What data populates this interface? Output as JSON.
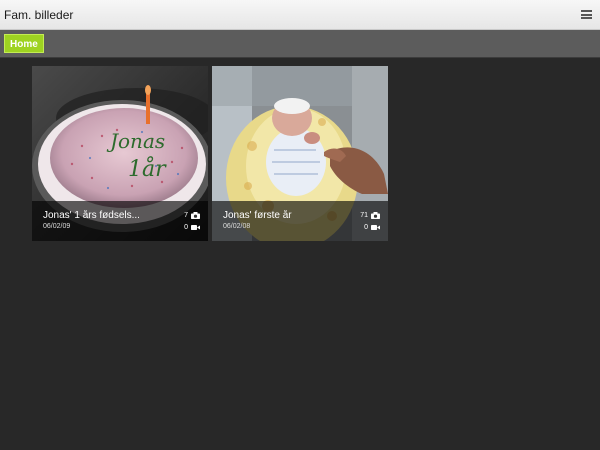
{
  "app": {
    "title": "Fam. billeder"
  },
  "nav": {
    "home_label": "Home"
  },
  "albums": [
    {
      "title": "Jonas' 1 års fødsels...",
      "date": "06/02/09",
      "photo_count": "7",
      "video_count": "0",
      "cake_text_line1": "Jonas",
      "cake_text_line2": "1år"
    },
    {
      "title": "Jonas' første år",
      "date": "06/02/08",
      "photo_count": "71",
      "video_count": "0"
    }
  ],
  "icons": {
    "menu": "hamburger-menu-icon",
    "photo": "camera-icon",
    "video": "video-camera-icon"
  },
  "colors": {
    "accent": "#9ed321",
    "background": "#282828",
    "navbar": "#5c5c5c"
  }
}
